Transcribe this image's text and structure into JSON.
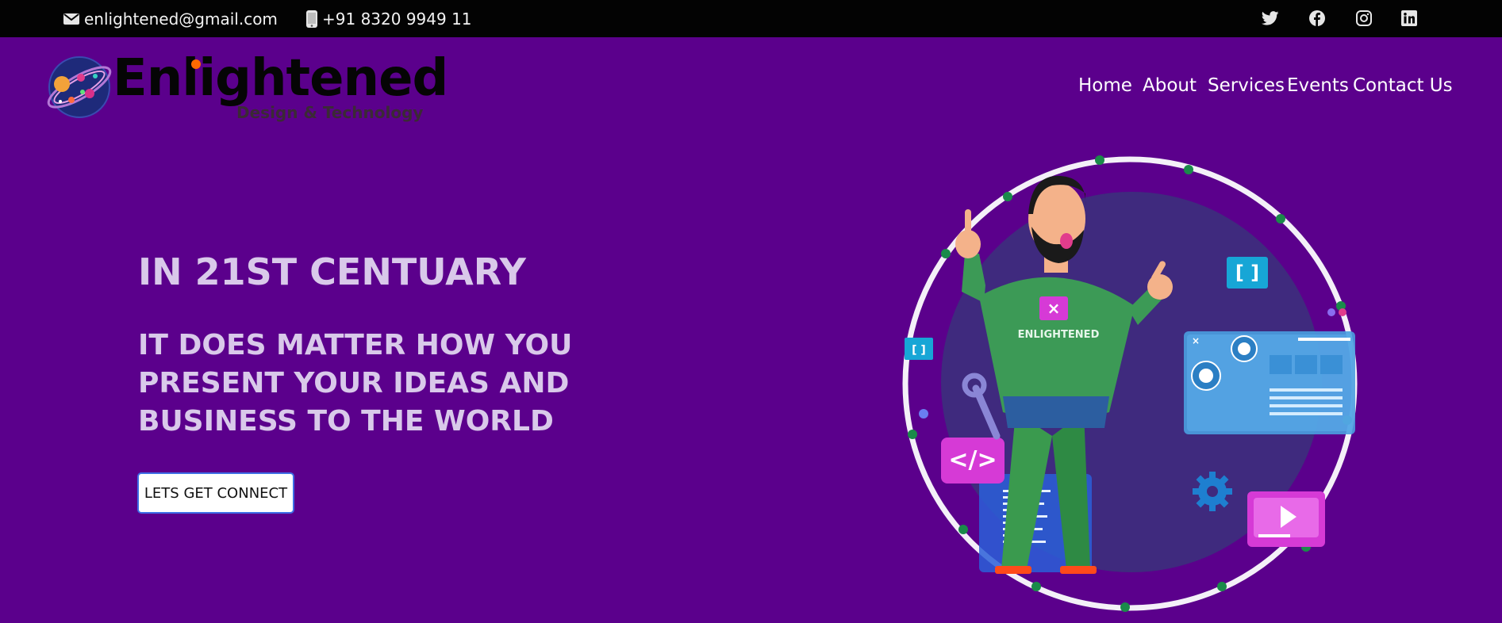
{
  "topbar": {
    "email": "enlightened@gmail.com",
    "phone": "+91 8320 9949 11",
    "email_icon": "envelope-icon",
    "phone_icon": "mobile-phone-icon",
    "social": [
      "twitter-icon",
      "facebook-icon",
      "instagram-icon",
      "linkedin-icon"
    ]
  },
  "header": {
    "logo_text": "Enlightened",
    "logo_tagline": "Design & Technology",
    "nav": [
      {
        "label": "Home"
      },
      {
        "label": "About"
      },
      {
        "label": "Services"
      },
      {
        "label": "Events"
      },
      {
        "label": "Contact Us"
      }
    ]
  },
  "hero": {
    "title": "IN 21ST CENTUARY",
    "subtitle": "IT DOES MATTER HOW YOU PRESENT YOUR IDEAS AND BUSINESS TO THE WORLD",
    "cta_label": "LETS GET CONNECT"
  },
  "illustration": {
    "shirt_text": "ENLIGHTENED",
    "brackets_label": "[ ]",
    "code_label": "</>"
  },
  "colors": {
    "background": "#5b008c",
    "topbar": "#030303",
    "hero_text": "#d9c9ea",
    "accent_green": "#1a8a4a"
  }
}
